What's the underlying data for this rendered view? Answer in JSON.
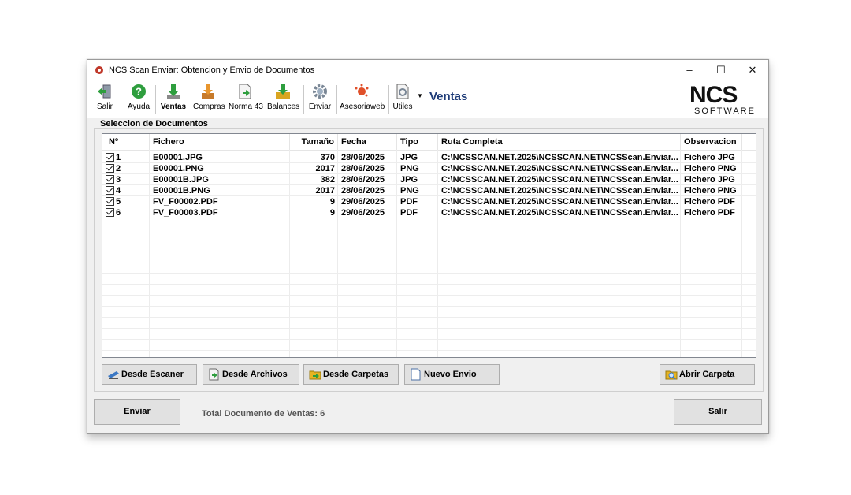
{
  "window": {
    "title": "NCS Scan Enviar: Obtencion y Envio de Documentos",
    "controls": {
      "minimize": "–",
      "maximize": "☐",
      "close": "✕"
    }
  },
  "toolbar": {
    "items": [
      {
        "label": "Salir",
        "icon": "exit-door-icon"
      },
      {
        "label": "Ayuda",
        "icon": "help-icon"
      },
      {
        "label": "Ventas",
        "icon": "download-arrow-icon"
      },
      {
        "label": "Compras",
        "icon": "download-box-icon"
      },
      {
        "label": "Norma 43",
        "icon": "document-arrow-icon"
      },
      {
        "label": "Balances",
        "icon": "download-folder-icon"
      },
      {
        "label": "Enviar",
        "icon": "gear-icon"
      },
      {
        "label": "Asesoriaweb",
        "icon": "dots-icon"
      },
      {
        "label": "Utiles",
        "icon": "document-gear-icon"
      }
    ],
    "section_title": "Ventas",
    "brand": {
      "name": "NCS",
      "sub": "SOFTWARE"
    }
  },
  "documents": {
    "group_label": "Seleccion de Documentos",
    "columns": [
      "Nº",
      "Fichero",
      "Tamaño",
      "Fecha",
      "Tipo",
      "Ruta Completa",
      "Observacion"
    ],
    "rows": [
      {
        "n": "1",
        "fichero": "E00001.JPG",
        "tamano": "370",
        "fecha": "28/06/2025",
        "tipo": "JPG",
        "ruta": "C:\\NCSSCAN.NET.2025\\NCSSCAN.NET\\NCSScan.Enviar...",
        "obs": "Fichero JPG"
      },
      {
        "n": "2",
        "fichero": "E00001.PNG",
        "tamano": "2017",
        "fecha": "28/06/2025",
        "tipo": "PNG",
        "ruta": "C:\\NCSSCAN.NET.2025\\NCSSCAN.NET\\NCSScan.Enviar...",
        "obs": "Fichero PNG"
      },
      {
        "n": "3",
        "fichero": "E00001B.JPG",
        "tamano": "382",
        "fecha": "28/06/2025",
        "tipo": "JPG",
        "ruta": "C:\\NCSSCAN.NET.2025\\NCSSCAN.NET\\NCSScan.Enviar...",
        "obs": "Fichero JPG"
      },
      {
        "n": "4",
        "fichero": "E00001B.PNG",
        "tamano": "2017",
        "fecha": "28/06/2025",
        "tipo": "PNG",
        "ruta": "C:\\NCSSCAN.NET.2025\\NCSSCAN.NET\\NCSScan.Enviar...",
        "obs": "Fichero PNG"
      },
      {
        "n": "5",
        "fichero": "FV_F00002.PDF",
        "tamano": "9",
        "fecha": "29/06/2025",
        "tipo": "PDF",
        "ruta": "C:\\NCSSCAN.NET.2025\\NCSSCAN.NET\\NCSScan.Enviar...",
        "obs": "Fichero PDF"
      },
      {
        "n": "6",
        "fichero": "FV_F00003.PDF",
        "tamano": "9",
        "fecha": "29/06/2025",
        "tipo": "PDF",
        "ruta": "C:\\NCSSCAN.NET.2025\\NCSSCAN.NET\\NCSScan.Enviar...",
        "obs": "Fichero PDF"
      }
    ]
  },
  "actions": {
    "desde_escaner": "Desde Escaner",
    "desde_archivos": "Desde Archivos",
    "desde_carpetas": "Desde Carpetas",
    "nuevo_envio": "Nuevo Envio",
    "abrir_carpeta": "Abrir Carpeta"
  },
  "footer": {
    "enviar": "Enviar",
    "status": "Total Documento de Ventas: 6",
    "salir": "Salir"
  },
  "colors": {
    "accent_title": "#1f3c78",
    "window_bg": "#f0f0f0",
    "button_bg": "#e1e1e1"
  }
}
